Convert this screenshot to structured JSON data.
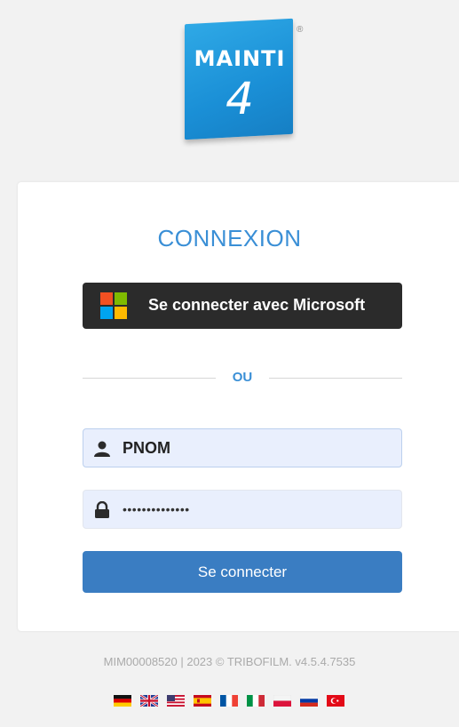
{
  "logo": {
    "line1": "MAINTI",
    "line2": "4",
    "registered": "®"
  },
  "login": {
    "title": "CONNEXION",
    "microsoft_button_label": "Se connecter avec Microsoft",
    "separator_label": "OU",
    "username_value": "PNOM",
    "password_value": "••••••••••••••",
    "submit_label": "Se connecter"
  },
  "footer": {
    "text": "MIM00008520 | 2023 © TRIBOFILM. v4.5.4.7535"
  },
  "languages": [
    "german-flag",
    "uk-flag",
    "us-flag",
    "spanish-flag",
    "french-flag",
    "italian-flag",
    "polish-flag",
    "russian-flag",
    "turkish-flag"
  ],
  "colors": {
    "accent": "#3a8fd6",
    "button": "#3a7dc2",
    "logo": "#1a8fd6",
    "ms_button": "#2b2b2b"
  }
}
